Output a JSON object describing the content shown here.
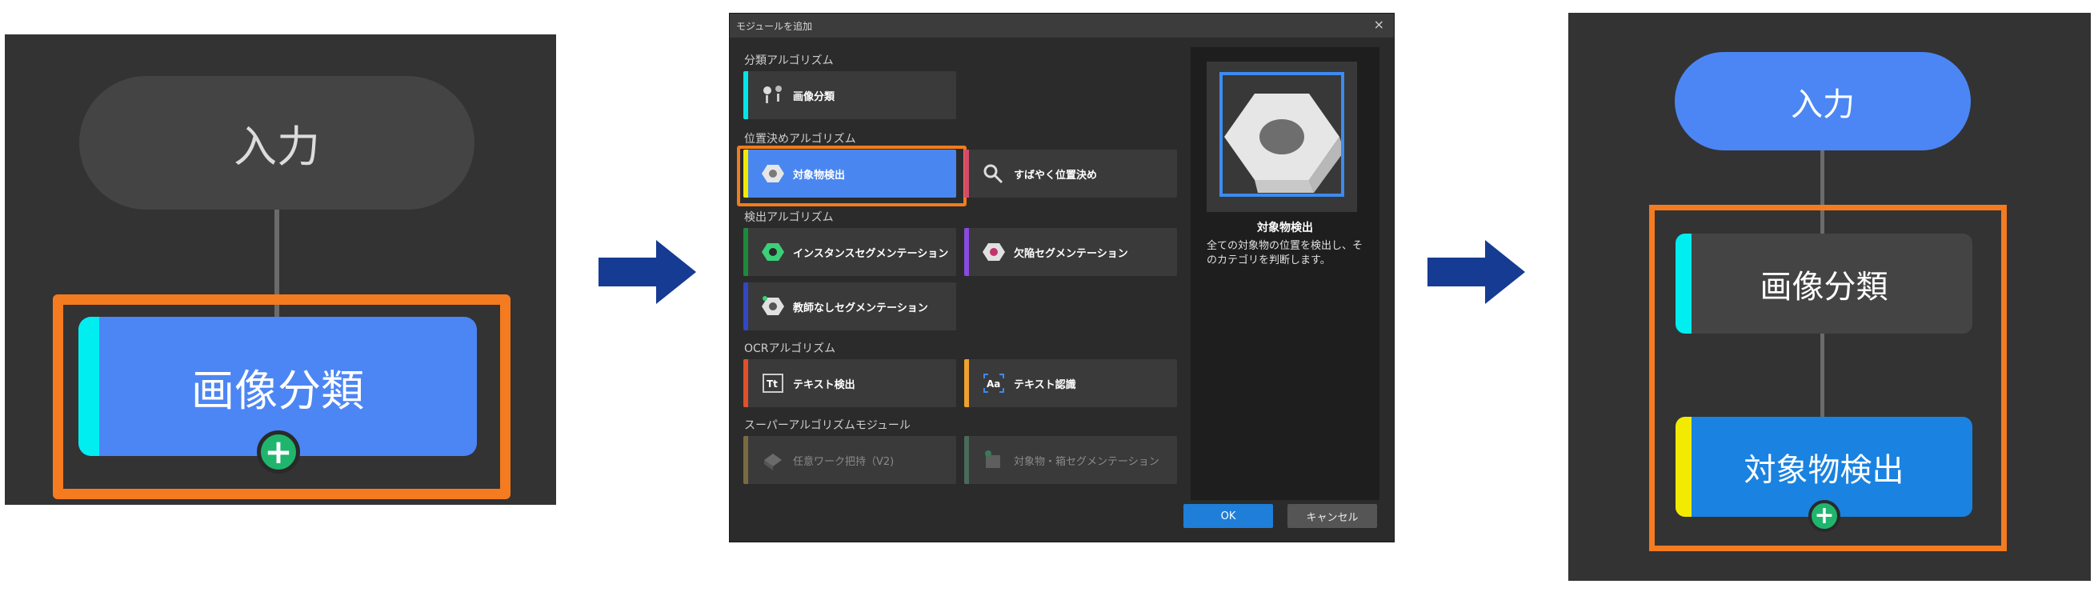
{
  "left_panel": {
    "input_node": "入力",
    "classify_node": "画像分類",
    "add_icon": "plus-icon",
    "highlight_color": "#f47b20",
    "node_color": "#4c86f5",
    "accent_color": "#00eef0"
  },
  "arrow_color": "#163b93",
  "dialog": {
    "title": "モジュールを追加",
    "close": "×",
    "sections": {
      "classification": "分類アルゴリズム",
      "positioning": "位置決めアルゴリズム",
      "detection": "検出アルゴリズム",
      "ocr": "OCRアルゴリズム",
      "super": "スーパーアルゴリズムモジュール"
    },
    "modules": {
      "image_classification": "画像分類",
      "object_detection": "対象物検出",
      "fast_positioning": "すばやく位置決め",
      "instance_segmentation": "インスタンスセグメンテーション",
      "defect_segmentation": "欠陥セグメンテーション",
      "unsupervised_segmentation": "教師なしセグメンテーション",
      "text_detection": "テキスト検出",
      "text_recognition": "テキスト認識",
      "arbitrary_grasp": "任意ワーク把持（V2)",
      "object_box_segmentation": "対象物・箱セグメンテーション"
    },
    "preview": {
      "title": "対象物検出",
      "description": "全ての対象物の位置を検出し、そのカテゴリを判断します。"
    },
    "ok": "OK",
    "cancel": "キャンセル"
  },
  "right_panel": {
    "input_node": "入力",
    "classify_node": "画像分類",
    "detect_node": "対象物検出",
    "add_icon": "plus-icon"
  }
}
